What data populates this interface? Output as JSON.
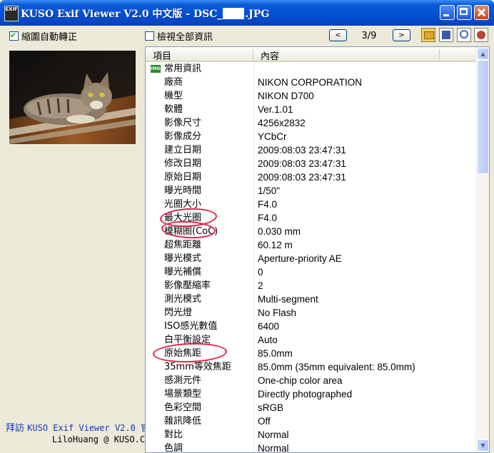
{
  "window": {
    "title_prefix": "KUSO Exif Viewer V2.0 中文版 - DSC_",
    "title_suffix": ".JPG",
    "app_icon_text": "EXIF"
  },
  "toolbar": {
    "auto_rotate_label": "縮圖自動轉正",
    "auto_rotate_checked": true,
    "show_all_label": "檢視全部資訊",
    "show_all_checked": false,
    "prev_label": "<",
    "next_label": ">",
    "counter": "3/9"
  },
  "icons": {
    "open": "open-folder-icon",
    "save": "save-disk-icon",
    "zoom": "magnifier-icon",
    "about": "about-icon"
  },
  "footer": {
    "visit_prefix": "拜訪 ",
    "visit_app": "KUSO Exif Viewer V2.0 官",
    "author": "LiloHuang @ KUSO.Co"
  },
  "list": {
    "col_item": "項目",
    "col_content": "內容",
    "group": "常用資訊",
    "group_icon_text": "IMG",
    "rows": [
      {
        "name": "廠商",
        "value": "NIKON CORPORATION"
      },
      {
        "name": "機型",
        "value": "NIKON D700"
      },
      {
        "name": "軟體",
        "value": "Ver.1.01"
      },
      {
        "name": "影像尺寸",
        "value": "4256x2832"
      },
      {
        "name": "影像成分",
        "value": "YCbCr"
      },
      {
        "name": "建立日期",
        "value": "2009:08:03 23:47:31"
      },
      {
        "name": "修改日期",
        "value": "2009:08:03 23:47:31"
      },
      {
        "name": "原始日期",
        "value": "2009:08:03 23:47:31"
      },
      {
        "name": "曝光時間",
        "value": "1/50\""
      },
      {
        "name": "光圈大小",
        "value": "F4.0"
      },
      {
        "name": "最大光圈",
        "value": "F4.0"
      },
      {
        "name": "模糊圈(CoC)",
        "value": "0.030 mm"
      },
      {
        "name": "超焦距離",
        "value": "60.12 m"
      },
      {
        "name": "曝光模式",
        "value": "Aperture-priority AE"
      },
      {
        "name": "曝光補償",
        "value": "0"
      },
      {
        "name": "影像壓縮率",
        "value": "2"
      },
      {
        "name": "測光模式",
        "value": "Multi-segment"
      },
      {
        "name": "閃光燈",
        "value": "No Flash"
      },
      {
        "name": "ISO感光數值",
        "value": "6400"
      },
      {
        "name": "白平衡設定",
        "value": "Auto"
      },
      {
        "name": "原始焦距",
        "value": "85.0mm"
      },
      {
        "name": "35mm等效焦距",
        "value": "85.0mm (35mm equivalent: 85.0mm)"
      },
      {
        "name": "感測元件",
        "value": "One-chip color area"
      },
      {
        "name": "場景類型",
        "value": "Directly photographed"
      },
      {
        "name": "色彩空間",
        "value": "sRGB"
      },
      {
        "name": "雜訊降低",
        "value": "Off"
      },
      {
        "name": "對比",
        "value": "Normal"
      },
      {
        "name": "色調",
        "value": "Normal"
      }
    ]
  }
}
